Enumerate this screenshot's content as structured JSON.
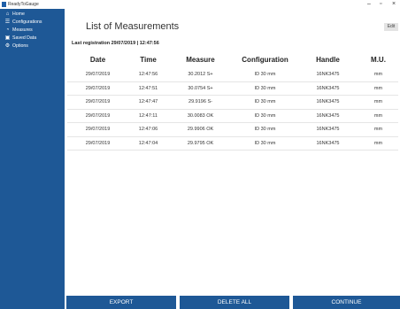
{
  "window": {
    "title": "ReadyToGauge",
    "controls": {
      "minimize": "–",
      "maximize": "▫",
      "close": "×"
    }
  },
  "sidebar": {
    "items": [
      {
        "label": "Home",
        "icon": "home-icon",
        "glyph": "⌂"
      },
      {
        "label": "Configurations",
        "icon": "list-icon",
        "glyph": "☰"
      },
      {
        "label": "Measures",
        "icon": "gauge-icon",
        "glyph": "◔"
      },
      {
        "label": "Saved Data",
        "icon": "save-icon",
        "glyph": "▣"
      },
      {
        "label": "Options",
        "icon": "gear-icon",
        "glyph": "⚙"
      }
    ]
  },
  "main": {
    "title": "List of Measurements",
    "edit_label": "Edit",
    "last_registration": "Last registration 29/07/2019 | 12:47:56",
    "table": {
      "headers": [
        "Date",
        "Time",
        "Measure",
        "Configuration",
        "Handle",
        "M.U."
      ],
      "rows": [
        [
          "29/07/2019",
          "12:47:56",
          "30.2012 S+",
          "ID 30 mm",
          "16NK3475",
          "mm"
        ],
        [
          "29/07/2019",
          "12:47:51",
          "30.0754 S+",
          "ID 30 mm",
          "16NK3475",
          "mm"
        ],
        [
          "29/07/2019",
          "12:47:47",
          "29.9196 S-",
          "ID 30 mm",
          "16NK3475",
          "mm"
        ],
        [
          "29/07/2019",
          "12:47:11",
          "30.0083 OK",
          "ID 30 mm",
          "16NK3475",
          "mm"
        ],
        [
          "29/07/2019",
          "12:47:06",
          "29.9906 OK",
          "ID 30 mm",
          "16NK3475",
          "mm"
        ],
        [
          "29/07/2019",
          "12:47:04",
          "29.9795 OK",
          "ID 30 mm",
          "16NK3475",
          "mm"
        ]
      ]
    }
  },
  "footer": {
    "export_label": "EXPORT",
    "delete_all_label": "DELETE ALL",
    "continue_label": "CONTINUE"
  },
  "colors": {
    "accent": "#1e5896",
    "background": "#ffffff"
  }
}
